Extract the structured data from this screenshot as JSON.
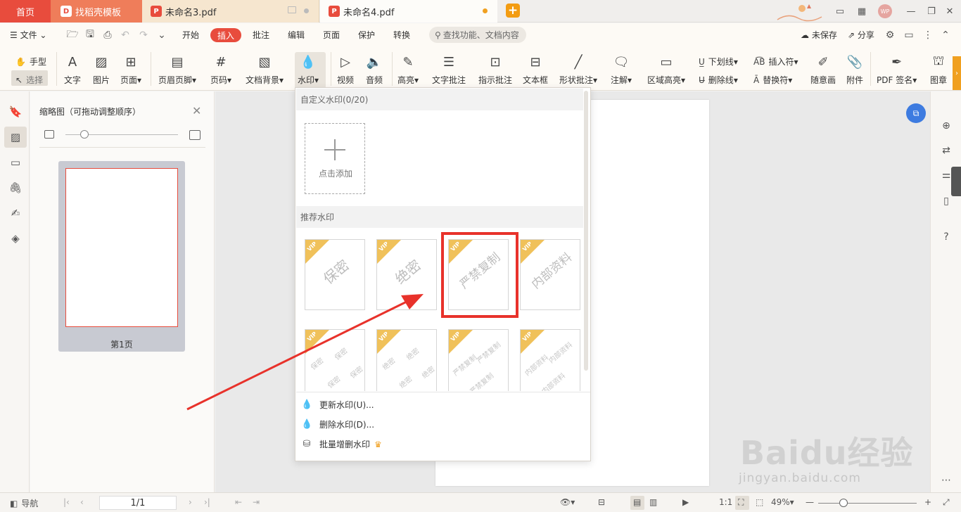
{
  "tabs": {
    "home": "首页",
    "template": "找稻壳模板",
    "doc3": "未命名3.pdf",
    "doc4": "未命名4.pdf",
    "avatar": "WP"
  },
  "menu": {
    "file": "文件",
    "items": [
      "开始",
      "插入",
      "批注",
      "编辑",
      "页面",
      "保护",
      "转换"
    ],
    "active": "插入",
    "search_placeholder": "查找功能、文档内容",
    "unsaved": "未保存",
    "share": "分享"
  },
  "toolbar": {
    "hand": "手型",
    "select": "选择",
    "text": "文字",
    "image": "图片",
    "page": "页面",
    "header_footer": "页眉页脚",
    "page_number": "页码",
    "doc_background": "文档背景",
    "watermark": "水印",
    "video": "视频",
    "audio": "音频",
    "highlight": "高亮",
    "text_comment": "文字批注",
    "pointer_comment": "指示批注",
    "text_box": "文本框",
    "shape_comment": "形状批注",
    "annotation": "注解",
    "area_highlight": "区域高亮",
    "underline": "下划线",
    "strikethrough": "删除线",
    "insert_symbol": "插入符",
    "replace_symbol": "替换符",
    "freehand": "随意画",
    "attachment": "附件",
    "pdf_sign": "PDF 签名",
    "stamp": "图章"
  },
  "thumbnail_panel": {
    "title": "缩略图（可拖动调整顺序）",
    "page_label": "第1页"
  },
  "watermark_dropdown": {
    "custom_header": "自定义水印(0/20)",
    "add_label": "点击添加",
    "recommended_header": "推荐水印",
    "vip": "VIP",
    "row1": [
      "保密",
      "绝密",
      "严禁复制",
      "内部资料"
    ],
    "row2": [
      "保密",
      "绝密",
      "严禁复制",
      "内部资料"
    ],
    "menu": [
      "更新水印(U)...",
      "删除水印(D)...",
      "批量增删水印"
    ]
  },
  "statusbar": {
    "nav": "导航",
    "page": "1/1",
    "zoom": "49%"
  },
  "brand": {
    "main": "Baidu经验",
    "sub": "jingyan.baidu.com"
  },
  "colors": {
    "accent": "#e84c3d",
    "highlight": "#e8322b",
    "vip": "#f0c15a"
  }
}
